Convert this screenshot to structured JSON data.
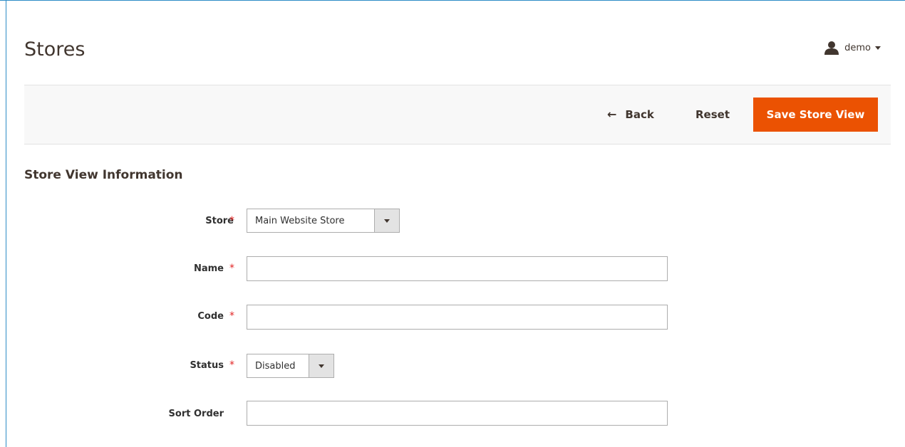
{
  "header": {
    "title": "Stores",
    "user": {
      "name": "demo",
      "icon": "user-icon"
    }
  },
  "actions": {
    "back_label": "Back",
    "back_icon": "arrow-left-icon",
    "reset_label": "Reset",
    "save_label": "Save Store View"
  },
  "form": {
    "section_title": "Store View Information",
    "required_marker": "*",
    "fields": {
      "store": {
        "label": "Store",
        "value": "Main Website Store",
        "required": true
      },
      "name": {
        "label": "Name",
        "value": "",
        "required": true
      },
      "code": {
        "label": "Code",
        "value": "",
        "required": true
      },
      "status": {
        "label": "Status",
        "value": "Disabled",
        "required": true
      },
      "sort_order": {
        "label": "Sort Order",
        "value": "",
        "required": false
      }
    }
  },
  "colors": {
    "accent": "#eb5202",
    "required": "#e22626",
    "frame": "#2d8cc6",
    "text": "#41362f"
  }
}
